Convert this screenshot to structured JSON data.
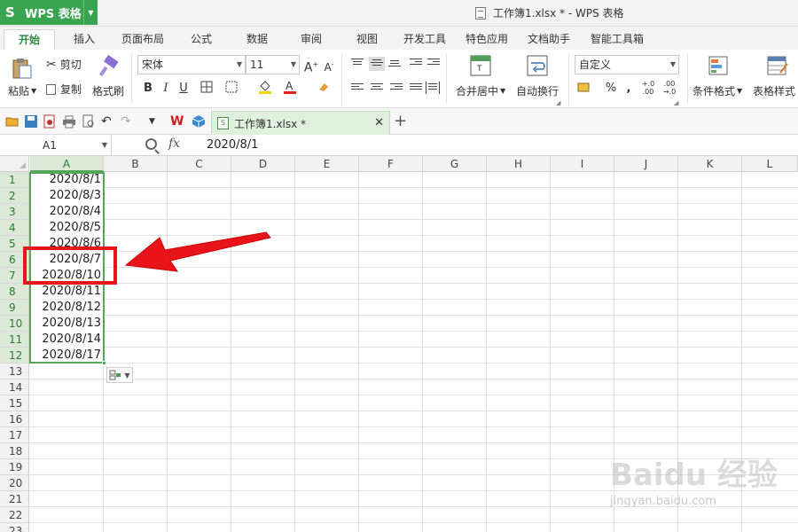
{
  "app": {
    "brand": "WPS 表格",
    "window_title": "工作簿1.xlsx * - WPS 表格"
  },
  "menu_tabs": [
    "开始",
    "插入",
    "页面布局",
    "公式",
    "数据",
    "审阅",
    "视图",
    "开发工具",
    "特色应用",
    "文档助手",
    "智能工具箱"
  ],
  "ribbon": {
    "paste": "粘贴",
    "cut": "剪切",
    "copy": "复制",
    "format_painter": "格式刷",
    "font_name": "宋体",
    "font_size": "11",
    "merge_center": "合并居中",
    "wrap_text": "自动换行",
    "number_format": "自定义",
    "conditional_format": "条件格式",
    "table_style": "表格样式"
  },
  "doc_tab": {
    "name": "工作簿1.xlsx *"
  },
  "formula_bar": {
    "cell_ref": "A1",
    "fx": "fx",
    "value": "2020/8/1"
  },
  "columns": [
    "A",
    "B",
    "C",
    "D",
    "E",
    "F",
    "G",
    "H",
    "I",
    "J",
    "K",
    "L"
  ],
  "rows": [
    "1",
    "2",
    "3",
    "4",
    "5",
    "6",
    "7",
    "8",
    "9",
    "10",
    "11",
    "12",
    "13",
    "14",
    "15",
    "16",
    "17",
    "18",
    "19",
    "20",
    "21",
    "22",
    "23"
  ],
  "cells_a": [
    "2020/8/1",
    "2020/8/3",
    "2020/8/4",
    "2020/8/5",
    "2020/8/6",
    "2020/8/7",
    "2020/8/10",
    "2020/8/11",
    "2020/8/12",
    "2020/8/13",
    "2020/8/14",
    "2020/8/17"
  ],
  "watermark": {
    "text": "Baidu 经验",
    "url_text": "jingyan.baidu.com"
  },
  "colors": {
    "accent_green": "#3aa551",
    "selection_green": "#55a65a",
    "annotation_red": "#e8141a"
  }
}
